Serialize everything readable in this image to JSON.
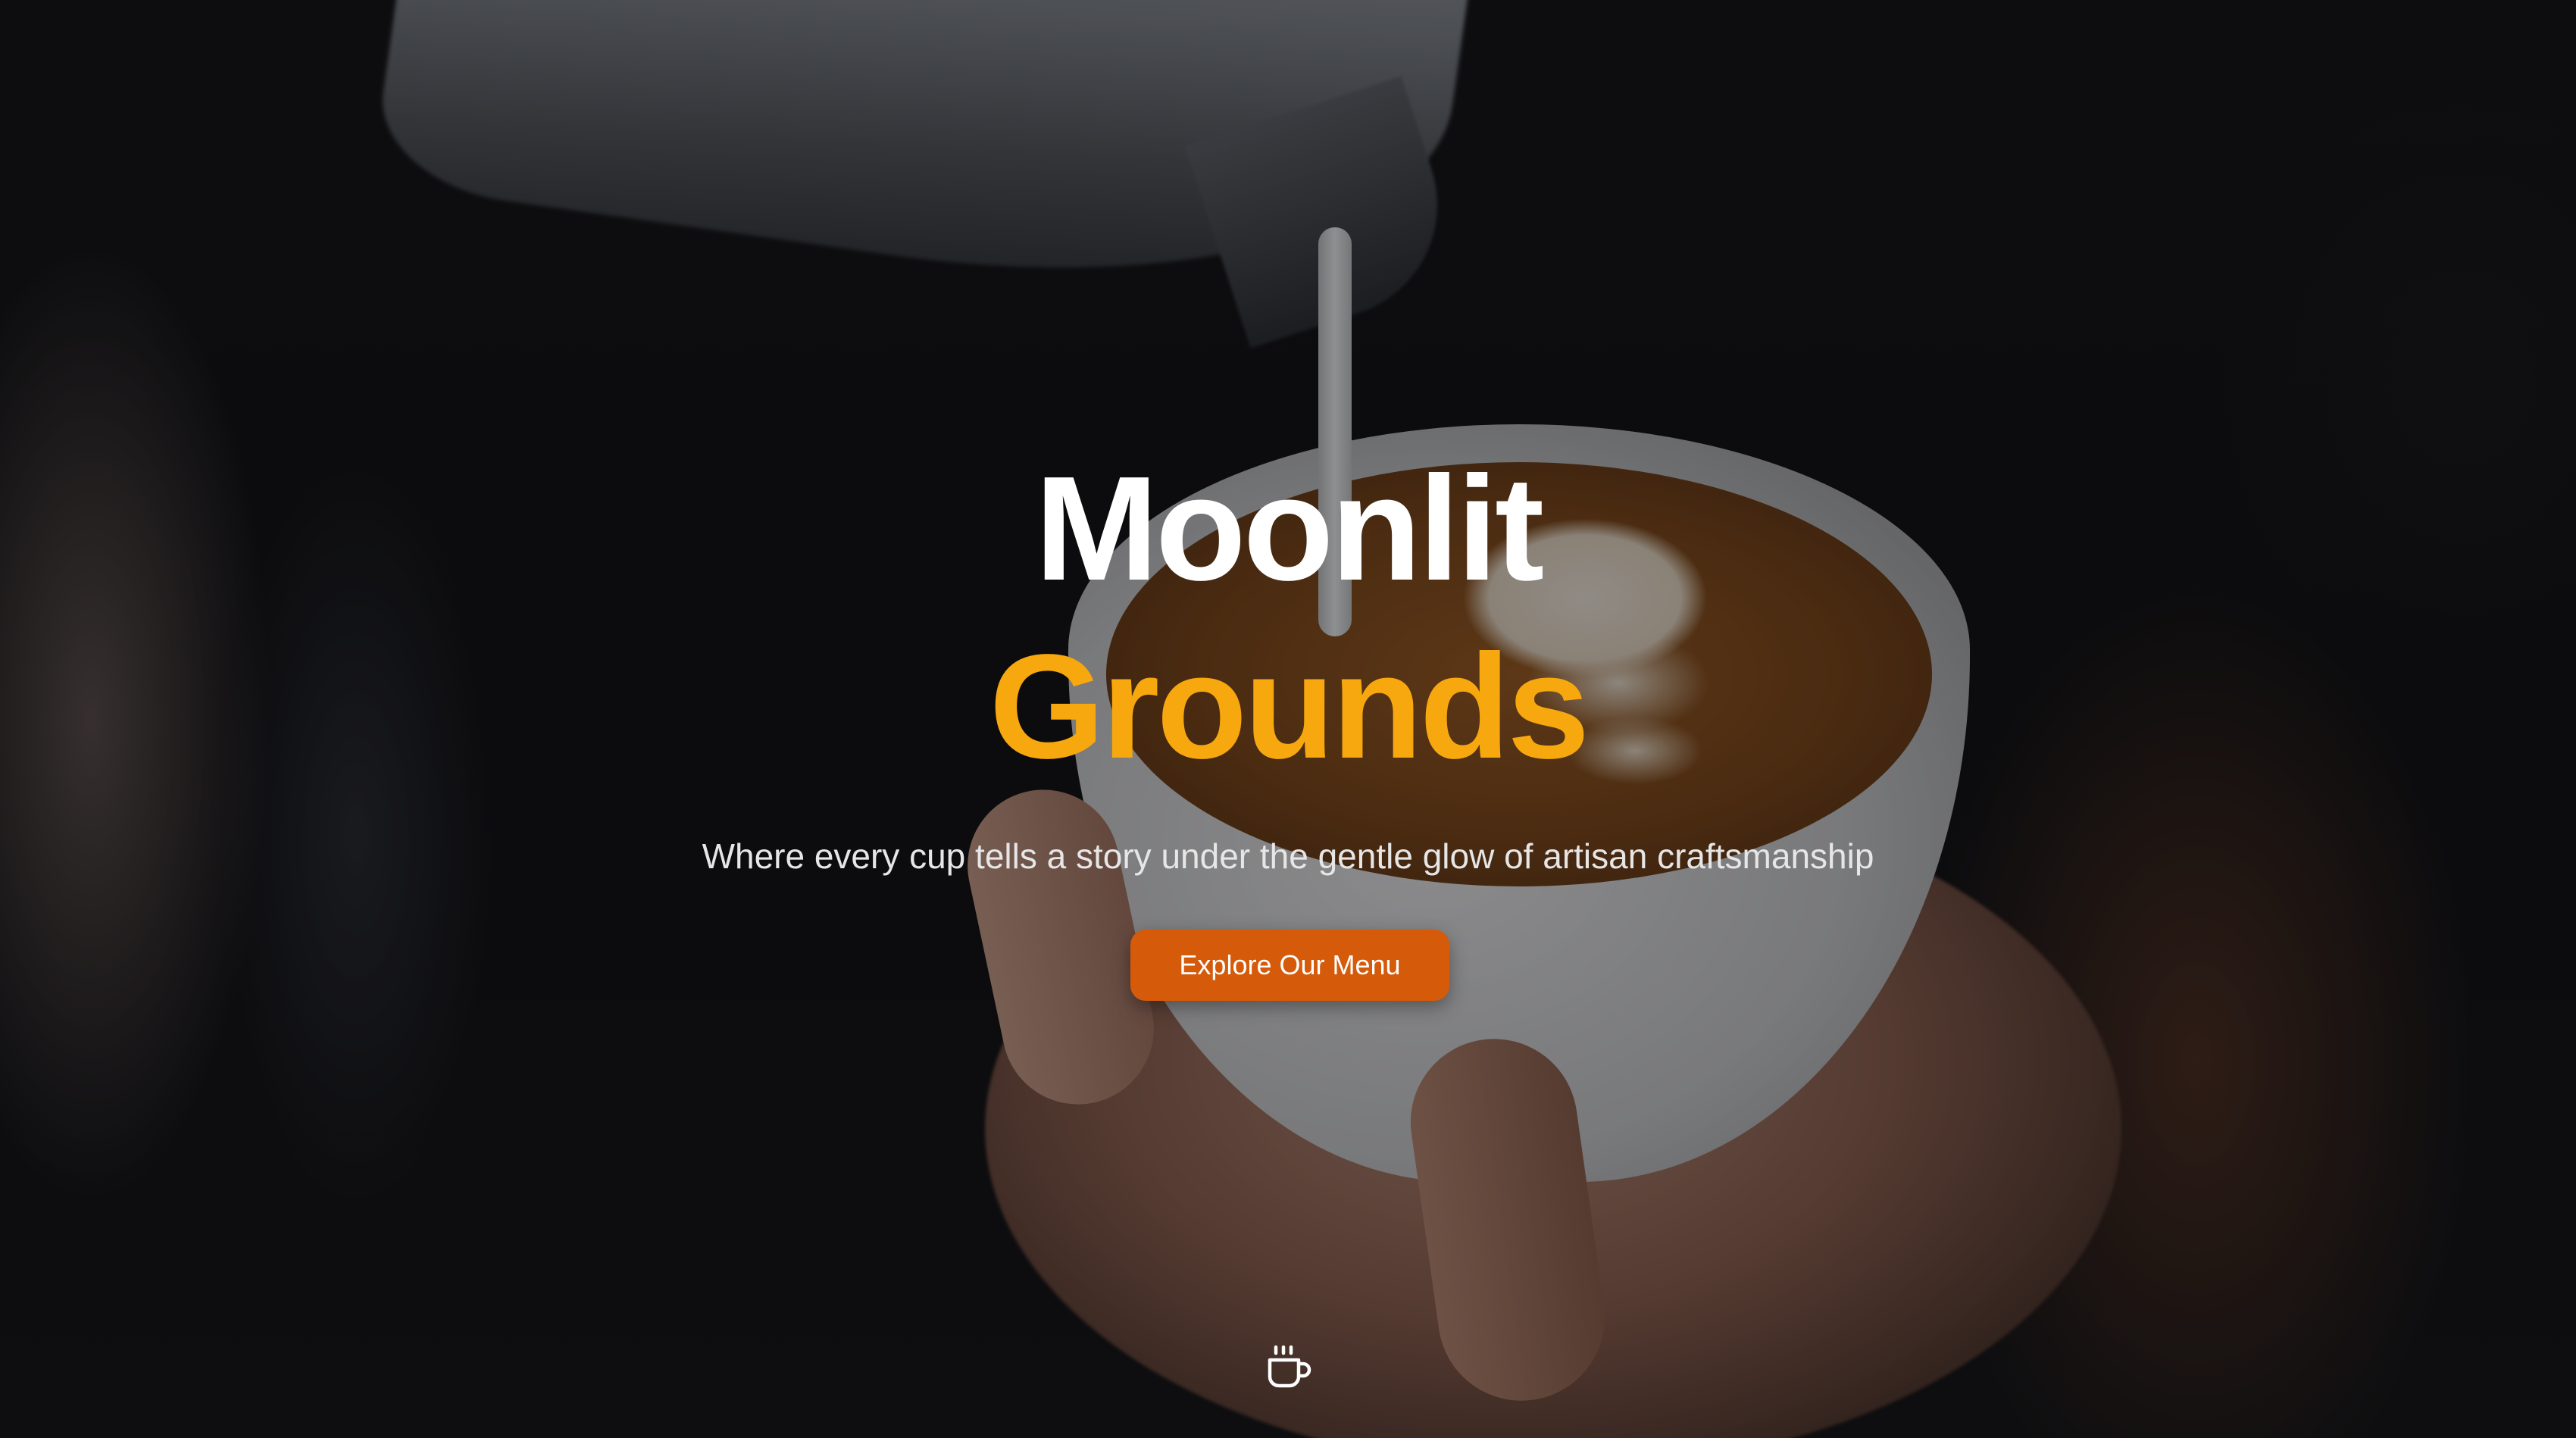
{
  "hero": {
    "title_line_1": "Moonlit",
    "title_line_2": "Grounds",
    "tagline": "Where every cup tells a story under the gentle glow of artisan craftsmanship",
    "cta_label": "Explore Our Menu",
    "scroll_icon": "coffee-cup-icon"
  },
  "colors": {
    "accent": "#f7a80e",
    "cta_background": "#d55a0a",
    "title_primary": "#ffffff",
    "tagline": "#e6e6e6"
  }
}
